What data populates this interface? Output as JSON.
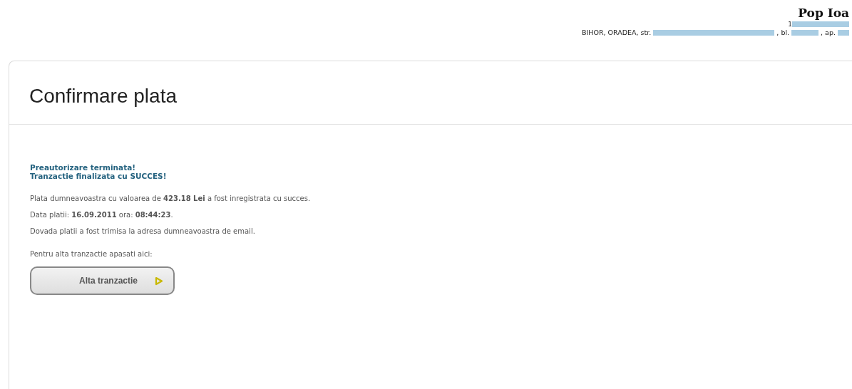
{
  "header": {
    "name": "Pop Ioa",
    "id_prefix": "1",
    "address": [
      {
        "kind": "text",
        "text": "BIHOR, ORADEA, str."
      },
      {
        "kind": "redacted"
      },
      {
        "kind": "text",
        "text": ", bl."
      },
      {
        "kind": "redacted"
      },
      {
        "kind": "text",
        "text": ", ap."
      },
      {
        "kind": "redacted"
      }
    ]
  },
  "card": {
    "title": "Confirmare plata",
    "status_lines": [
      "Preautorizare terminata!",
      "Tranzactie finalizata cu SUCCES!"
    ],
    "paragraphs": [
      "Plata dumneavoastra cu valoarea de **423.18 Lei** a fost inregistrata cu succes.",
      "Data platii: **16.09.2011** ora: **08:44:23**.",
      "Dovada platii a fost trimisa la adresa dumneavoastra de email.",
      "Pentru alta tranzactie apasati aici:"
    ],
    "button": {
      "label": "Alta tranzactie"
    }
  }
}
